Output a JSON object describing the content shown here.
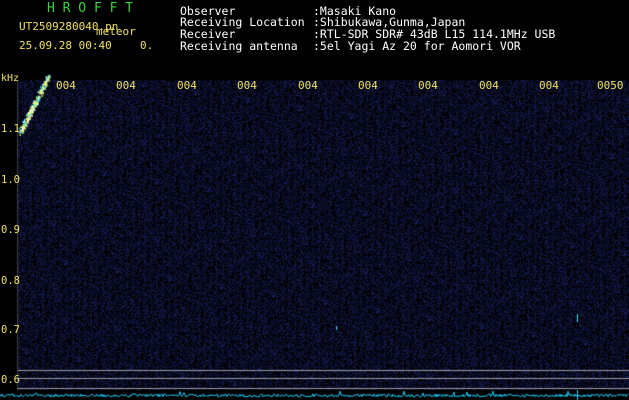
{
  "header": {
    "app_title": "H R O F F T",
    "file_name": "UT2509280040.pn",
    "meteor_label": "meteor",
    "date_time": "25.09.28 00:40",
    "count_value": "0.",
    "info": [
      {
        "label": "Observer",
        "value": ":Masaki Kano"
      },
      {
        "label": "Receiving Location",
        "value": ":Shibukawa,Gunma,Japan"
      },
      {
        "label": "Receiver",
        "value": ":RTL-SDR SDR# 43dB L15 114.1MHz USB"
      },
      {
        "label": "Receiving antenna",
        "value": ":5el Yagi Az 20 for Aomori VOR"
      }
    ]
  },
  "spectrogram": {
    "frequency_unit": "kHz",
    "time_ticks": [
      "004",
      "004",
      "004",
      "004",
      "004",
      "004",
      "004",
      "004",
      "004",
      "0050"
    ],
    "freq_ticks": [
      "1.1",
      "1.0",
      "0.9",
      "0.8",
      "0.7",
      "0.6"
    ],
    "colors": {
      "background": "#000000",
      "noise": "#1a2a70",
      "signal": "#e8ff60",
      "trace": "#20d0ff",
      "labels": "#f0e060"
    }
  }
}
